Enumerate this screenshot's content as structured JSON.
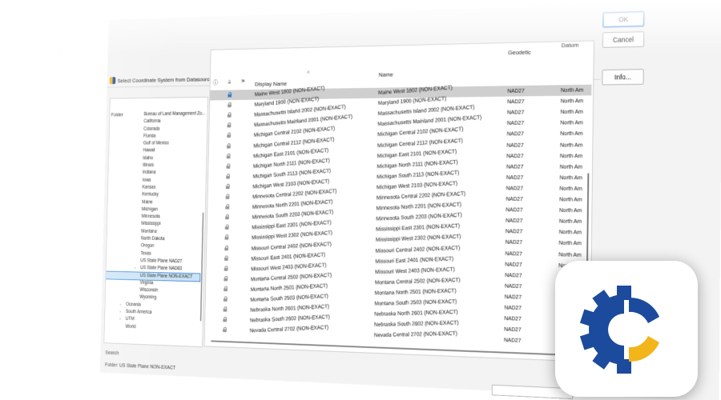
{
  "window": {
    "title": "Select Coordinate System from Datasource"
  },
  "buttons": {
    "ok": "OK",
    "cancel": "Cancel",
    "info": "Info..."
  },
  "tree": {
    "header": "Folder",
    "items": [
      {
        "label": "Bureau of Land Management Zo...",
        "level": 1
      },
      {
        "label": "California",
        "level": 1
      },
      {
        "label": "Colorado",
        "level": 1
      },
      {
        "label": "Florida",
        "level": 1
      },
      {
        "label": "Gulf of Mexico",
        "level": 1
      },
      {
        "label": "Hawaii",
        "level": 1
      },
      {
        "label": "Idaho",
        "level": 1
      },
      {
        "label": "Illinois",
        "level": 1
      },
      {
        "label": "Indiana",
        "level": 1
      },
      {
        "label": "Iowa",
        "level": 1
      },
      {
        "label": "Kansas",
        "level": 1
      },
      {
        "label": "Kentucky",
        "level": 1
      },
      {
        "label": "Maine",
        "level": 1
      },
      {
        "label": "Michigan",
        "level": 1
      },
      {
        "label": "Minnesota",
        "level": 1
      },
      {
        "label": "Mississippi",
        "level": 1
      },
      {
        "label": "Montana",
        "level": 1
      },
      {
        "label": "North Dakota",
        "level": 1
      },
      {
        "label": "Oregon",
        "level": 1
      },
      {
        "label": "Texas",
        "level": 1
      },
      {
        "label": "US State Plane NAD27",
        "level": 1
      },
      {
        "label": "US State Plane NAD83",
        "level": 1,
        "twisty": "›"
      },
      {
        "label": "US State Plane NON-EXACT",
        "level": 1,
        "selected": true
      },
      {
        "label": "Virginia",
        "level": 1
      },
      {
        "label": "Wisconsin",
        "level": 1
      },
      {
        "label": "Wyoming",
        "level": 1
      },
      {
        "label": "Oceania",
        "level": 0,
        "twisty": "›"
      },
      {
        "label": "South America",
        "level": 0,
        "twisty": "›"
      },
      {
        "label": "UTM",
        "level": 0,
        "twisty": "›"
      },
      {
        "label": "World",
        "level": 0
      }
    ]
  },
  "grid": {
    "columns": {
      "display_name": "Display Name",
      "name": "Name",
      "geodetic": "Geodetic",
      "datum": "Datum"
    },
    "rows": [
      {
        "display": "Maine West 1802 (NON-EXACT)",
        "name": "Maine West 1802 (NON-EXACT)",
        "geo": "NAD27",
        "datum": "North Am",
        "selected": true
      },
      {
        "display": "Maryland 1900 (NON-EXACT)",
        "name": "Maryland 1900 (NON-EXACT)",
        "geo": "NAD27",
        "datum": "North Am"
      },
      {
        "display": "Massachusetts Island 2002 (NON-EXACT)",
        "name": "Massachusetts Island 2002 (NON-EXACT)",
        "geo": "NAD27",
        "datum": "North Am"
      },
      {
        "display": "Massachusetts Mainland 2001 (NON-EXACT)",
        "name": "Massachusetts Mainland 2001 (NON-EXACT)",
        "geo": "NAD27",
        "datum": "North Am"
      },
      {
        "display": "Michigan Central 2102 (NON-EXACT)",
        "name": "Michigan Central 2102 (NON-EXACT)",
        "geo": "NAD27",
        "datum": "North Am"
      },
      {
        "display": "Michigan Central 2112 (NON-EXACT)",
        "name": "Michigan Central 2112 (NON-EXACT)",
        "geo": "NAD27",
        "datum": "North Am"
      },
      {
        "display": "Michigan East 2101 (NON-EXACT)",
        "name": "Michigan East 2101 (NON-EXACT)",
        "geo": "NAD27",
        "datum": "North Am"
      },
      {
        "display": "Michigan North 2111 (NON-EXACT)",
        "name": "Michigan North 2111 (NON-EXACT)",
        "geo": "NAD27",
        "datum": "North Am"
      },
      {
        "display": "Michigan South 2113 (NON-EXACT)",
        "name": "Michigan South 2113 (NON-EXACT)",
        "geo": "NAD27",
        "datum": "North Am"
      },
      {
        "display": "Michigan West 2103 (NON-EXACT)",
        "name": "Michigan West 2103 (NON-EXACT)",
        "geo": "NAD27",
        "datum": "North Am"
      },
      {
        "display": "Minnesota Central 2202 (NON-EXACT)",
        "name": "Minnesota Central 2202 (NON-EXACT)",
        "geo": "NAD27",
        "datum": "North Am"
      },
      {
        "display": "Minnesota North 2201 (NON-EXACT)",
        "name": "Minnesota North 2201 (NON-EXACT)",
        "geo": "NAD27",
        "datum": "North Am"
      },
      {
        "display": "Minnesota South 2203 (NON-EXACT)",
        "name": "Minnesota South 2203 (NON-EXACT)",
        "geo": "NAD27",
        "datum": "North Am"
      },
      {
        "display": "Mississippi East 2301 (NON-EXACT)",
        "name": "Mississippi East 2301 (NON-EXACT)",
        "geo": "NAD27",
        "datum": "North Am"
      },
      {
        "display": "Mississippi West 2302 (NON-EXACT)",
        "name": "Mississippi West 2302 (NON-EXACT)",
        "geo": "NAD27",
        "datum": "North Am"
      },
      {
        "display": "Missouri Central 2402 (NON-EXACT)",
        "name": "Missouri Central 2402 (NON-EXACT)",
        "geo": "NAD27",
        "datum": "North Am"
      },
      {
        "display": "Missouri East 2401 (NON-EXACT)",
        "name": "Missouri East 2401 (NON-EXACT)",
        "geo": "NAD27",
        "datum": "North Am"
      },
      {
        "display": "Missouri West 2403 (NON-EXACT)",
        "name": "Missouri West 2403 (NON-EXACT)",
        "geo": "NAD27",
        "datum": "North Am"
      },
      {
        "display": "Montana Central 2502 (NON-EXACT)",
        "name": "Montana Central 2502 (NON-EXACT)",
        "geo": "NAD27",
        "datum": "North Am"
      },
      {
        "display": "Montana North 2501 (NON-EXACT)",
        "name": "Montana North 2501 (NON-EXACT)",
        "geo": "NAD27",
        "datum": "North Am"
      },
      {
        "display": "Montana South 2503 (NON-EXACT)",
        "name": "Montana South 2503 (NON-EXACT)",
        "geo": "NAD27",
        "datum": "North Am"
      },
      {
        "display": "Nebraska North 2601 (NON-EXACT)",
        "name": "Nebraska North 2601 (NON-EXACT)",
        "geo": "NAD27",
        "datum": "North Am"
      },
      {
        "display": "Nebraska South 2602 (NON-EXACT)",
        "name": "Nebraska South 2602 (NON-EXACT)",
        "geo": "NAD27",
        "datum": "North Am"
      },
      {
        "display": "Nevada Central 2702 (NON-EXACT)",
        "name": "Nevada Central 2702 (NON-EXACT)",
        "geo": "NAD27",
        "datum": "North Am"
      }
    ]
  },
  "footer": {
    "search_label": "Search",
    "folder_text": "Folder: US State Plane NON-EXACT"
  },
  "colors": {
    "brand_blue": "#1c4a9c",
    "brand_yellow": "#f2b51a",
    "selection": "#cce4f7"
  },
  "icons": {
    "app": "app-logo-icon",
    "lock": "lock-icon",
    "info": "info-icon"
  }
}
